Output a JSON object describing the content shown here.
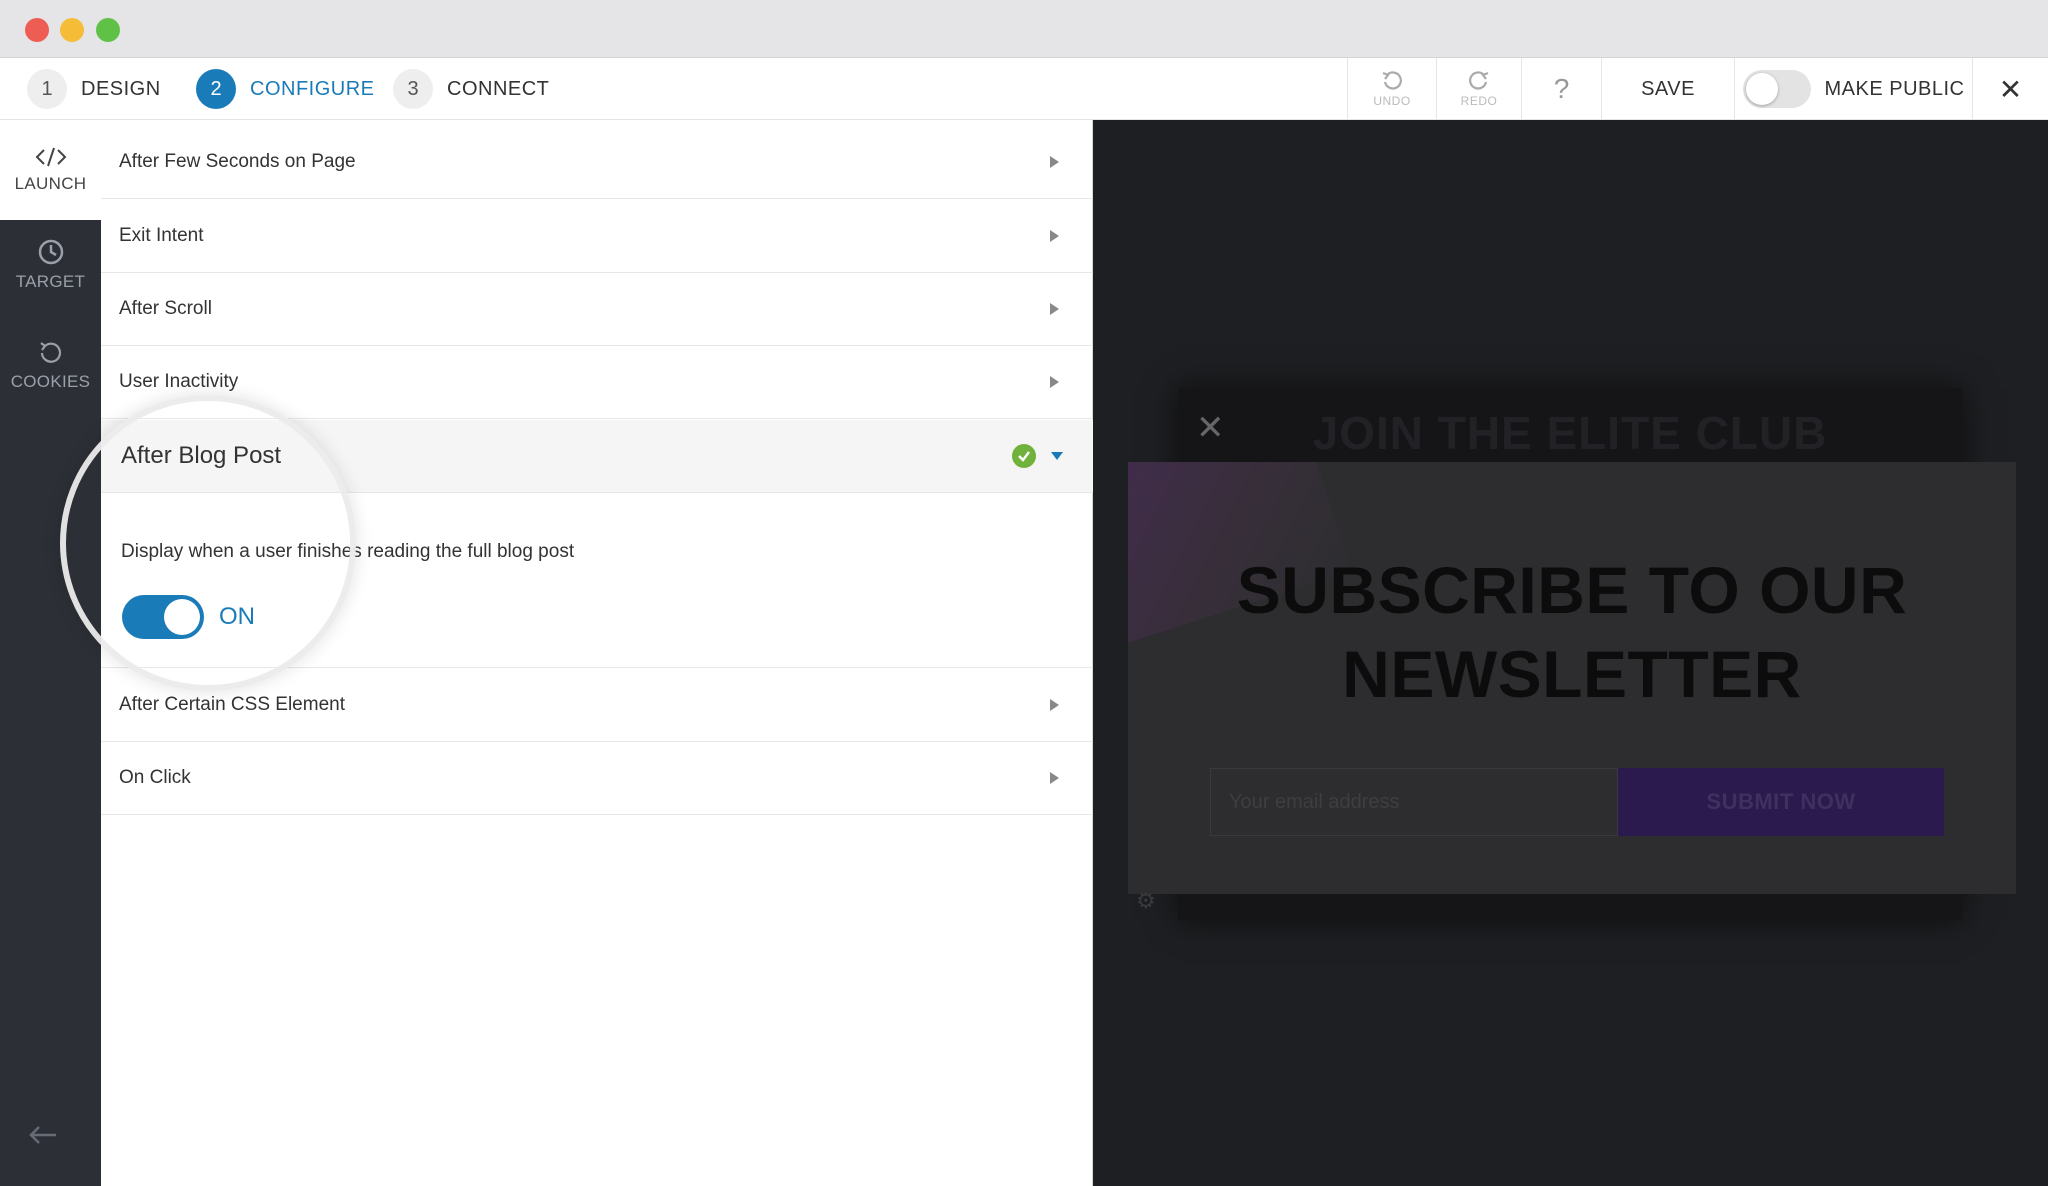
{
  "window": {
    "controls": [
      "close",
      "minimize",
      "maximize"
    ]
  },
  "steps": [
    {
      "num": "1",
      "label": "DESIGN"
    },
    {
      "num": "2",
      "label": "CONFIGURE"
    },
    {
      "num": "3",
      "label": "CONNECT"
    }
  ],
  "toolbar": {
    "undo_label": "UNDO",
    "redo_label": "REDO",
    "help_label": "?",
    "save_label": "SAVE",
    "make_public_label": "MAKE PUBLIC",
    "close_label": "✕"
  },
  "sidebar": {
    "items": [
      {
        "label": "LAUNCH",
        "icon": "code-icon"
      },
      {
        "label": "TARGET",
        "icon": "clock-icon"
      },
      {
        "label": "COOKIES",
        "icon": "refresh-icon"
      }
    ],
    "back_icon": "arrow-left-icon"
  },
  "triggers": {
    "rows": [
      "After Few Seconds on Page",
      "Exit Intent",
      "After Scroll",
      "User Inactivity"
    ],
    "expanded": {
      "title": "After Blog Post",
      "description": "Display when a user finishes reading the full blog post",
      "toggle_label": "ON"
    },
    "rows_after": [
      "After Certain CSS Element",
      "On Click"
    ]
  },
  "preview": {
    "back_title": "JOIN THE ELITE CLUB",
    "title_line1": "SUBSCRIBE TO OUR",
    "title_line2": "NEWSLETTER",
    "email_placeholder": "Your  email address",
    "submit_label": "SUBMIT NOW"
  },
  "colors": {
    "accent": "#1a7bb9",
    "check": "#71b23d",
    "sidebar": "#2c2f36"
  }
}
